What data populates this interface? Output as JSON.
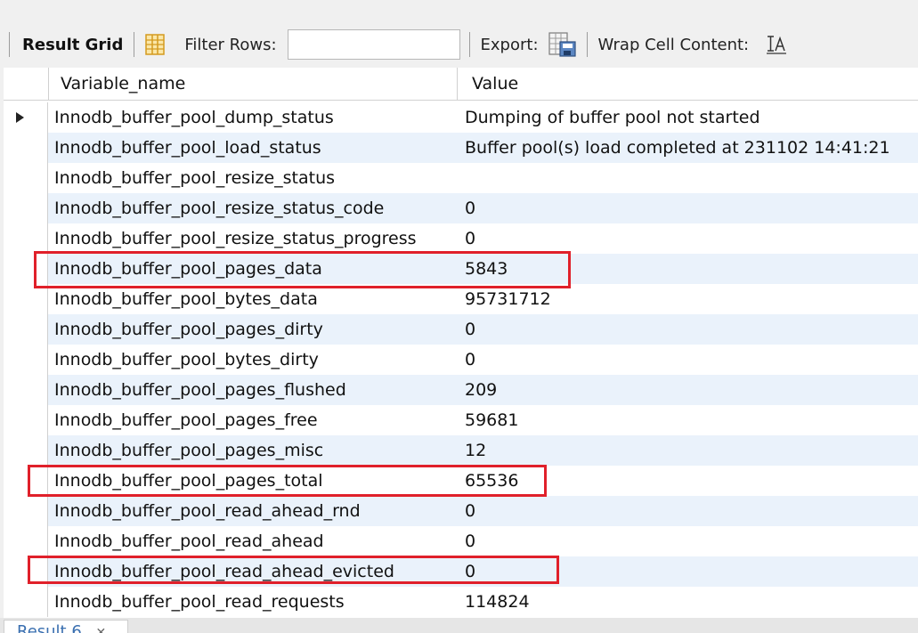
{
  "toolbar": {
    "result_grid_label": "Result Grid",
    "filter_label": "Filter Rows:",
    "filter_value": "",
    "export_label": "Export:",
    "wrap_label": "Wrap Cell Content:"
  },
  "grid": {
    "columns": [
      "Variable_name",
      "Value"
    ],
    "rows": [
      {
        "name": "Innodb_buffer_pool_dump_status",
        "value": "Dumping of buffer pool not started"
      },
      {
        "name": "Innodb_buffer_pool_load_status",
        "value": "Buffer pool(s) load completed at 231102 14:41:21"
      },
      {
        "name": "Innodb_buffer_pool_resize_status",
        "value": ""
      },
      {
        "name": "Innodb_buffer_pool_resize_status_code",
        "value": "0"
      },
      {
        "name": "Innodb_buffer_pool_resize_status_progress",
        "value": "0"
      },
      {
        "name": "Innodb_buffer_pool_pages_data",
        "value": "5843"
      },
      {
        "name": "Innodb_buffer_pool_bytes_data",
        "value": "95731712"
      },
      {
        "name": "Innodb_buffer_pool_pages_dirty",
        "value": "0"
      },
      {
        "name": "Innodb_buffer_pool_bytes_dirty",
        "value": "0"
      },
      {
        "name": "Innodb_buffer_pool_pages_flushed",
        "value": "209"
      },
      {
        "name": "Innodb_buffer_pool_pages_free",
        "value": "59681"
      },
      {
        "name": "Innodb_buffer_pool_pages_misc",
        "value": "12"
      },
      {
        "name": "Innodb_buffer_pool_pages_total",
        "value": "65536"
      },
      {
        "name": "Innodb_buffer_pool_read_ahead_rnd",
        "value": "0"
      },
      {
        "name": "Innodb_buffer_pool_read_ahead",
        "value": "0"
      },
      {
        "name": "Innodb_buffer_pool_read_ahead_evicted",
        "value": "0"
      },
      {
        "name": "Innodb_buffer_pool_read_requests",
        "value": "114824"
      }
    ]
  },
  "bottom_tab": {
    "label": "Result 6"
  },
  "colors": {
    "highlight": "#e0202a",
    "alt_row": "#eaf2fb"
  }
}
